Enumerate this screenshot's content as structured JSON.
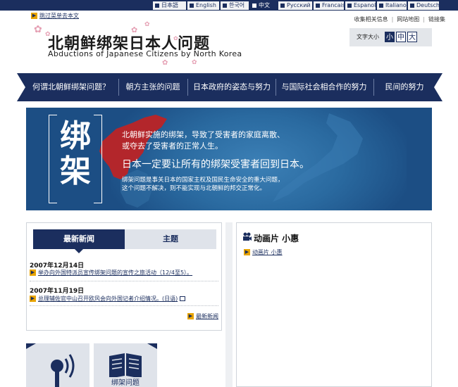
{
  "languages": [
    {
      "label": "日本語"
    },
    {
      "label": "English"
    },
    {
      "label": "한국어"
    },
    {
      "label": "中文"
    },
    {
      "label": "Русский"
    },
    {
      "label": "Francais"
    },
    {
      "label": "Espanol"
    },
    {
      "label": "Italiano"
    },
    {
      "label": "Deutsch"
    }
  ],
  "header": {
    "skip_link": "跳过菜单去本文",
    "title_cn": "北朝鲜绑架日本人问题",
    "title_en": "Abductions of Japanese Citizens by North Korea",
    "links": [
      "收集相关信息",
      "网站地图",
      "链接集"
    ],
    "font_size_label": "文字大小",
    "font_sizes": [
      "小",
      "中",
      "大"
    ]
  },
  "nav": [
    "何谓北朝鲜绑架问题？",
    "朝方主张的问题",
    "日本政府的姿态与努力",
    "与国际社会相合作的努力",
    "民间的努力"
  ],
  "hero": {
    "kanji": [
      "绑",
      "架"
    ],
    "line1": "北朝鲜实施的绑架，导致了受害者的家庭离散、",
    "line2": "或夺去了受害者的正常人生。",
    "line3": "日本一定要让所有的绑架受害者回到日本。",
    "line4": "绑架问题是事关日本的国家主权及国民生命安全的重大问题，",
    "line5": "这个问题不解决，则不能实现与北朝鲜的邦交正常化。"
  },
  "news": {
    "tab_news": "最新新闻",
    "tab_theme": "主题",
    "items": [
      {
        "date": "2007年12月14日",
        "text": "举办向外国特派员宣传绑架问题的宣传之旅活动（12/4至5）。"
      },
      {
        "date": "2007年11月19日",
        "text": "总理辅佐官中山召开欧风会向外国记者介绍情况。(日语)"
      }
    ],
    "more": "最新新闻"
  },
  "bottom_boxes": [
    {
      "icon": "audio-icon",
      "caption": ""
    },
    {
      "icon": "book-icon",
      "caption": "绑架问题"
    }
  ],
  "video": {
    "title": "动画片  小惠",
    "link": "动画片  小惠"
  },
  "colors": {
    "navy": "#1b2e5e",
    "accent": "#e8a400",
    "hero_blue": "#1c4e84",
    "map_red": "#b3262b"
  }
}
